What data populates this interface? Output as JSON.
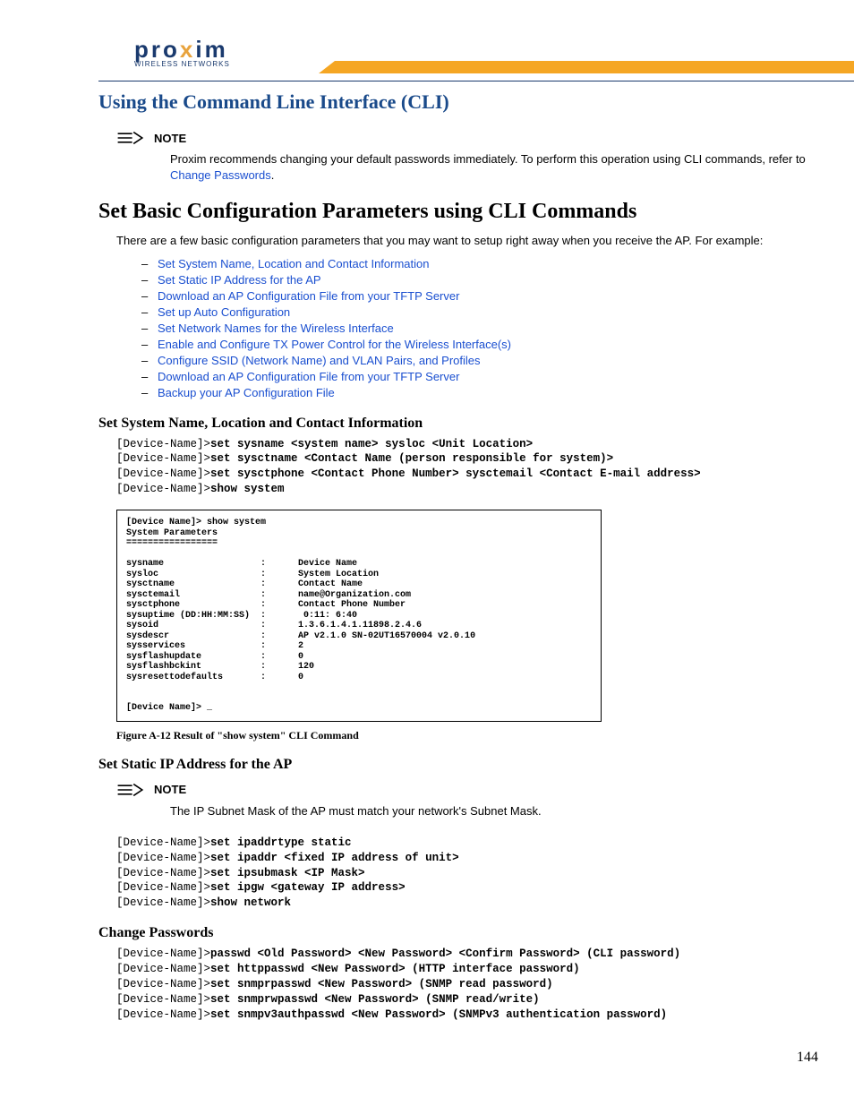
{
  "logo": {
    "text": "pro",
    "x": "x",
    "rest": "im",
    "sub": "WIRELESS NETWORKS"
  },
  "section_title": "Using the Command Line Interface (CLI)",
  "note1": {
    "label": "NOTE",
    "text_pre": "Proxim recommends changing your default passwords immediately. To perform this operation using CLI commands, refer to ",
    "link": "Change Passwords",
    "text_post": "."
  },
  "h1": "Set Basic Configuration Parameters using CLI Commands",
  "intro": "There are a few basic configuration parameters that you may want to setup right away when you receive the AP. For example:",
  "links": [
    "Set System Name, Location and Contact Information",
    "Set Static IP Address for the AP",
    "Download an AP Configuration File from your TFTP Server",
    "Set up Auto Configuration",
    "Set Network Names for the Wireless Interface",
    "Enable and Configure TX Power Control for the Wireless Interface(s)",
    "Configure SSID (Network Name) and VLAN Pairs, and Profiles",
    "Download an AP Configuration File from your TFTP Server",
    "Backup your AP Configuration File"
  ],
  "sec_sysname": {
    "title": "Set System Name, Location and Contact Information",
    "lines": [
      {
        "p": "[Device-Name]>",
        "c": "set sysname <system name> sysloc <Unit Location>"
      },
      {
        "p": "[Device-Name]>",
        "c": "set sysctname <Contact Name (person responsible for system)>"
      },
      {
        "p": "[Device-Name]>",
        "c": "set sysctphone <Contact Phone Number> sysctemail <Contact E-mail address>"
      },
      {
        "p": "[Device-Name]>",
        "c": "show system"
      }
    ]
  },
  "figure": {
    "caption": "Figure A-12   Result of \"show system\" CLI Command",
    "header1": "[Device Name]> show system",
    "header2": "System Parameters",
    "header3": "=================",
    "rows": [
      [
        "sysname",
        "Device Name"
      ],
      [
        "sysloc",
        "System Location"
      ],
      [
        "sysctname",
        "Contact Name"
      ],
      [
        "sysctemail",
        "name@Organization.com"
      ],
      [
        "sysctphone",
        "Contact Phone Number"
      ],
      [
        "sysuptime (DD:HH:MM:SS)",
        " 0:11: 6:40"
      ],
      [
        "sysoid",
        "1.3.6.1.4.1.11898.2.4.6"
      ],
      [
        "sysdescr",
        "AP v2.1.0 SN-02UT16570004 v2.0.10"
      ],
      [
        "sysservices",
        "2"
      ],
      [
        "sysflashupdate",
        "0"
      ],
      [
        "sysflashbckint",
        "120"
      ],
      [
        "sysresettodefaults",
        "0"
      ]
    ],
    "footer": "[Device Name]> _"
  },
  "sec_static": {
    "title": "Set Static IP Address for the AP",
    "note_label": "NOTE",
    "note_text": "The IP Subnet Mask of the AP must match your network's Subnet Mask.",
    "lines": [
      {
        "p": "[Device-Name]>",
        "c": "set ipaddrtype static"
      },
      {
        "p": "[Device-Name]>",
        "c": "set ipaddr <fixed IP address of unit>"
      },
      {
        "p": "[Device-Name]>",
        "c": "set ipsubmask <IP Mask>"
      },
      {
        "p": "[Device-Name]>",
        "c": "set ipgw <gateway IP address>"
      },
      {
        "p": "[Device-Name]>",
        "c": "show network"
      }
    ]
  },
  "sec_pass": {
    "title": "Change Passwords",
    "lines": [
      {
        "p": "[Device-Name]>",
        "c": "passwd <Old Password> <New Password> <Confirm Password> (CLI password)"
      },
      {
        "p": "[Device-Name]>",
        "c": "set httppasswd <New Password> (HTTP interface password)"
      },
      {
        "p": "[Device-Name]>",
        "c": "set snmprpasswd <New Password> (SNMP read password)"
      },
      {
        "p": "[Device-Name]>",
        "c": "set snmprwpasswd <New Password> (SNMP read/write)"
      },
      {
        "p": "[Device-Name]>",
        "c": "set snmpv3authpasswd <New Password> (SNMPv3 authentication password)"
      }
    ]
  },
  "page_number": "144"
}
